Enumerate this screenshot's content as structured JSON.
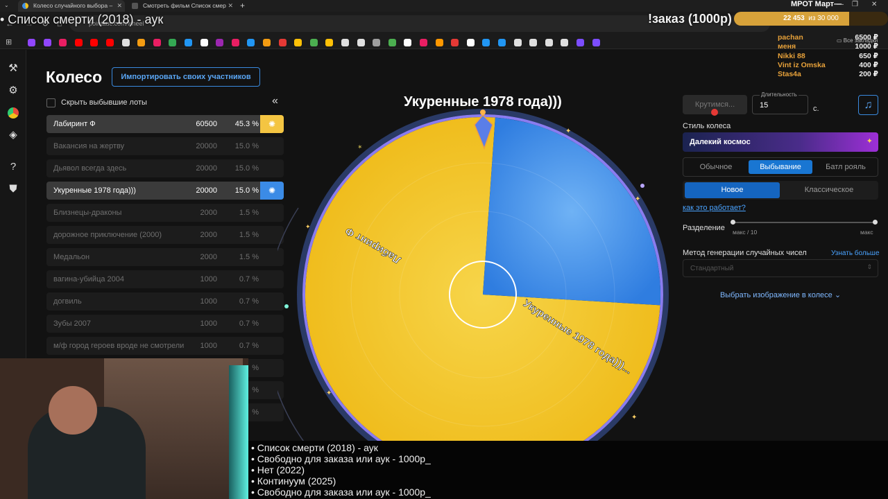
{
  "browser": {
    "tabs": [
      {
        "title": "Колесо случайного выбора –",
        "active": true
      },
      {
        "title": "Смотреть фильм Список смер",
        "active": false
      }
    ],
    "url": "pointauc.com/wheel",
    "bookmarks_all": "Все закладки"
  },
  "overlay": {
    "stream_title": "• Список смерти (2018) - аук",
    "order_label": "!заказ (1000р)",
    "goal_title": "МРОТ Март—",
    "goal_progress": "22 453",
    "goal_total": "из 30 000",
    "goal_fraction": 0.748,
    "donors": [
      {
        "name": "pachan",
        "amount": "6500 ₽"
      },
      {
        "name": "меня",
        "amount": "1000 ₽"
      },
      {
        "name": "Nikki 88",
        "amount": "650 ₽"
      },
      {
        "name": "Vint iz Omska",
        "amount": "400 ₽"
      },
      {
        "name": "Stas4a",
        "amount": "200 ₽"
      }
    ],
    "subtitle_lines": [
      "• Список смерти (2018) - аук",
      "• Свободно для заказа или аук - 1000р_",
      "• Нет (2022)",
      "• Континуум (2025)",
      "• Свободно для заказа или аук - 1000р_"
    ]
  },
  "page": {
    "title": "Колесо",
    "import_button": "Импортировать своих участников",
    "hide_lots_label": "Скрыть выбывшие лоты",
    "collapse_icon": "«"
  },
  "lots": [
    {
      "name": "Лабиринт Ф",
      "amount": "60500",
      "percent": "45.3 %",
      "state": "alive",
      "color": "#f4c542"
    },
    {
      "name": "Вакансия на жертву",
      "amount": "20000",
      "percent": "15.0 %",
      "state": "dead"
    },
    {
      "name": "Дьявол всегда здесь",
      "amount": "20000",
      "percent": "15.0 %",
      "state": "dead"
    },
    {
      "name": "Укуренные 1978 года)))",
      "amount": "20000",
      "percent": "15.0 %",
      "state": "alive",
      "color": "#3b8be6"
    },
    {
      "name": "Близнецы-драконы",
      "amount": "2000",
      "percent": "1.5 %",
      "state": "dead"
    },
    {
      "name": "дорожное приключение (2000)",
      "amount": "2000",
      "percent": "1.5 %",
      "state": "dead"
    },
    {
      "name": "Медальон",
      "amount": "2000",
      "percent": "1.5 %",
      "state": "dead"
    },
    {
      "name": "вагина-убийца 2004",
      "amount": "1000",
      "percent": "0.7 %",
      "state": "dead"
    },
    {
      "name": "догвиль",
      "amount": "1000",
      "percent": "0.7 %",
      "state": "dead"
    },
    {
      "name": "Зубы 2007",
      "amount": "1000",
      "percent": "0.7 %",
      "state": "dead"
    },
    {
      "name": "м/ф город героев вроде не смотрели",
      "amount": "1000",
      "percent": "0.7 %",
      "state": "dead"
    },
    {
      "name": "",
      "amount": "",
      "percent": "%",
      "state": "dead"
    },
    {
      "name": "",
      "amount": "",
      "percent": "%",
      "state": "dead"
    },
    {
      "name": "",
      "amount": "",
      "percent": "%",
      "state": "dead"
    }
  ],
  "wheel": {
    "winner_title": "Укуренные 1978 года)))",
    "chart_data": {
      "type": "pie",
      "slices": [
        {
          "label": "Лабиринт Ф",
          "value": 60500,
          "color": "#f2c21b"
        },
        {
          "label": "Укуренные 1978 года)))...",
          "value": 20000,
          "color": "#3d8fe8"
        }
      ]
    }
  },
  "controls": {
    "spin_button": "Крутимся...",
    "duration_label": "Длительность",
    "duration_value": "15",
    "duration_unit": "с.",
    "wheel_style_label": "Стиль колеса",
    "wheel_style_value": "Далекий космос",
    "mode_tabs": [
      "Обычное",
      "Выбывание",
      "Батл рояль"
    ],
    "mode_selected": "Выбывание",
    "sub_tabs": [
      "Новое",
      "Классическое"
    ],
    "sub_selected": "Новое",
    "how_link": "как это работает?",
    "split_label": "Разделение",
    "split_min": "макс / 10",
    "split_max": "макс",
    "rng_label": "Метод генерации случайных чисел",
    "rng_link": "Узнать больше",
    "rng_value": "Стандартный",
    "image_picker": "Выбрать изображение в колесе"
  }
}
